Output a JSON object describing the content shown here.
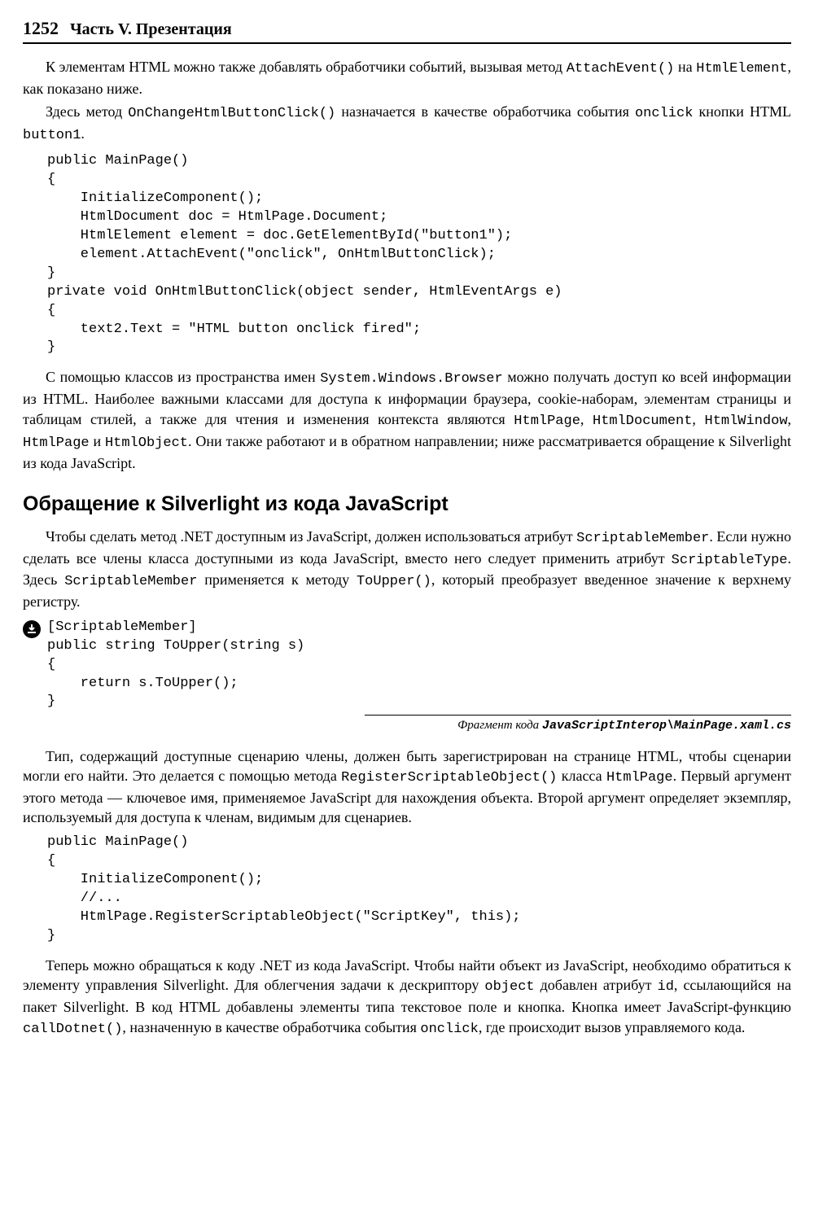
{
  "header": {
    "pageNumber": "1252",
    "title": "Часть V. Презентация"
  },
  "para1_a": "К элементам HTML можно также добавлять обработчики событий, вызывая метод ",
  "para1_code1": "AttachEvent()",
  "para1_b": " на ",
  "para1_code2": "HtmlElement",
  "para1_c": ", как показано ниже.",
  "para2_a": "Здесь метод ",
  "para2_code1": "OnChangeHtmlButtonClick()",
  "para2_b": " назначается в качестве обработчика события ",
  "para2_code2": "onclick",
  "para2_c": " кнопки HTML ",
  "para2_code3": "button1",
  "para2_d": ".",
  "code1": "public MainPage()\n{\n    InitializeComponent();\n    HtmlDocument doc = HtmlPage.Document;\n    HtmlElement element = doc.GetElementById(\"button1\");\n    element.AttachEvent(\"onclick\", OnHtmlButtonClick);\n}\nprivate void OnHtmlButtonClick(object sender, HtmlEventArgs e)\n{\n    text2.Text = \"HTML button onclick fired\";\n}",
  "para3_a": "С помощью классов из пространства имен ",
  "para3_code1": "System.Windows.Browser",
  "para3_b": " можно получать доступ ко всей информации из HTML. Наиболее важными классами для доступа к информации браузера, cookie-наборам, элементам страницы и таблицам стилей, а также для чтения и изменения контекста являются ",
  "para3_code2": "HtmlPage",
  "para3_code3": "HtmlDocument",
  "para3_code4": "HtmlWindow",
  "para3_code5": "HtmlPage",
  "para3_and": " и ",
  "para3_code6": "HtmlObject",
  "para3_c": ". Они также работают и в обратном направлении; ниже рассматривается обращение к Silverlight из кода JavaScript.",
  "sectionTitle": "Обращение к Silverlight из кода JavaScript",
  "para4_a": "Чтобы сделать метод .NET доступным из JavaScript, должен использоваться атрибут ",
  "para4_code1": "ScriptableMember",
  "para4_b": ". Если нужно сделать все члены класса доступными из кода JavaScript, вместо него следует применить атрибут ",
  "para4_code2": "ScriptableType",
  "para4_c": ". Здесь ",
  "para4_code3": "ScriptableMember",
  "para4_d": " применяется к методу ",
  "para4_code4": "ToUpper()",
  "para4_e": ", который преобразует введенное значение к верхнему регистру.",
  "code2": "[ScriptableMember]\npublic string ToUpper(string s)\n{\n    return s.ToUpper();\n}",
  "snippet_label": "Фрагмент кода ",
  "snippet_path": "JavaScriptInterop\\MainPage.xaml.cs",
  "para5_a": "Тип, содержащий доступные сценарию члены, должен быть зарегистрирован на странице HTML, чтобы сценарии могли его найти. Это делается с помощью метода ",
  "para5_code1": "RegisterScriptableObject()",
  "para5_b": " класса ",
  "para5_code2": "HtmlPage",
  "para5_c": ". Первый аргумент этого метода — ключевое имя, применяемое JavaScript для нахождения объекта. Второй аргумент определяет экземпляр, используемый для доступа к членам, видимым для сценариев.",
  "code3": "public MainPage()\n{\n    InitializeComponent();\n    //...\n    HtmlPage.RegisterScriptableObject(\"ScriptKey\", this);\n}",
  "para6_a": "Теперь можно обращаться к коду .NET из кода JavaScript. Чтобы найти объект из JavaScript, необходимо обратиться к элементу управления Silverlight. Для облегчения задачи к дескриптору ",
  "para6_code1": "object",
  "para6_b": " добавлен атрибут ",
  "para6_code2": "id",
  "para6_c": ", ссылающийся на пакет Silverlight. В код HTML добавлены элементы типа текстовое поле и кнопка. Кнопка имеет JavaScript-функцию ",
  "para6_code3": "callDotnet()",
  "para6_d": ", назначенную в качестве обработчика события ",
  "para6_code4": "onclick",
  "para6_e": ", где происходит вызов управляемого кода."
}
